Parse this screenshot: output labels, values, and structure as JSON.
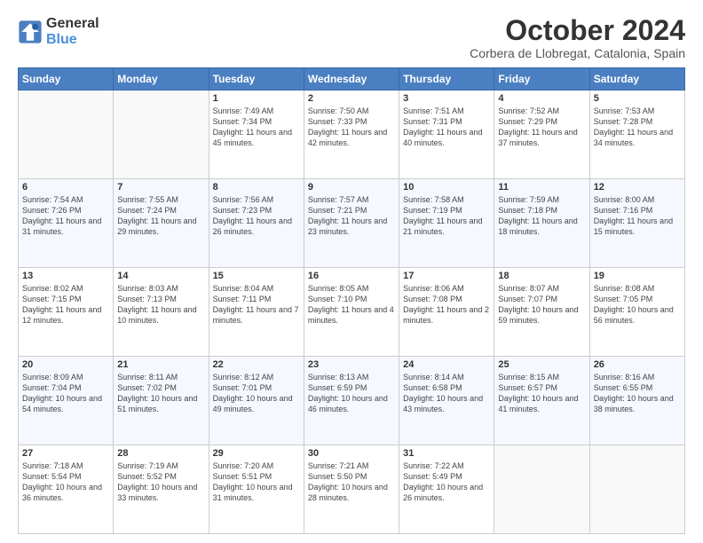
{
  "header": {
    "logo_line1": "General",
    "logo_line2": "Blue",
    "month": "October 2024",
    "location": "Corbera de Llobregat, Catalonia, Spain"
  },
  "weekdays": [
    "Sunday",
    "Monday",
    "Tuesday",
    "Wednesday",
    "Thursday",
    "Friday",
    "Saturday"
  ],
  "weeks": [
    [
      {
        "day": "",
        "info": ""
      },
      {
        "day": "",
        "info": ""
      },
      {
        "day": "1",
        "info": "Sunrise: 7:49 AM\nSunset: 7:34 PM\nDaylight: 11 hours and 45 minutes."
      },
      {
        "day": "2",
        "info": "Sunrise: 7:50 AM\nSunset: 7:33 PM\nDaylight: 11 hours and 42 minutes."
      },
      {
        "day": "3",
        "info": "Sunrise: 7:51 AM\nSunset: 7:31 PM\nDaylight: 11 hours and 40 minutes."
      },
      {
        "day": "4",
        "info": "Sunrise: 7:52 AM\nSunset: 7:29 PM\nDaylight: 11 hours and 37 minutes."
      },
      {
        "day": "5",
        "info": "Sunrise: 7:53 AM\nSunset: 7:28 PM\nDaylight: 11 hours and 34 minutes."
      }
    ],
    [
      {
        "day": "6",
        "info": "Sunrise: 7:54 AM\nSunset: 7:26 PM\nDaylight: 11 hours and 31 minutes."
      },
      {
        "day": "7",
        "info": "Sunrise: 7:55 AM\nSunset: 7:24 PM\nDaylight: 11 hours and 29 minutes."
      },
      {
        "day": "8",
        "info": "Sunrise: 7:56 AM\nSunset: 7:23 PM\nDaylight: 11 hours and 26 minutes."
      },
      {
        "day": "9",
        "info": "Sunrise: 7:57 AM\nSunset: 7:21 PM\nDaylight: 11 hours and 23 minutes."
      },
      {
        "day": "10",
        "info": "Sunrise: 7:58 AM\nSunset: 7:19 PM\nDaylight: 11 hours and 21 minutes."
      },
      {
        "day": "11",
        "info": "Sunrise: 7:59 AM\nSunset: 7:18 PM\nDaylight: 11 hours and 18 minutes."
      },
      {
        "day": "12",
        "info": "Sunrise: 8:00 AM\nSunset: 7:16 PM\nDaylight: 11 hours and 15 minutes."
      }
    ],
    [
      {
        "day": "13",
        "info": "Sunrise: 8:02 AM\nSunset: 7:15 PM\nDaylight: 11 hours and 12 minutes."
      },
      {
        "day": "14",
        "info": "Sunrise: 8:03 AM\nSunset: 7:13 PM\nDaylight: 11 hours and 10 minutes."
      },
      {
        "day": "15",
        "info": "Sunrise: 8:04 AM\nSunset: 7:11 PM\nDaylight: 11 hours and 7 minutes."
      },
      {
        "day": "16",
        "info": "Sunrise: 8:05 AM\nSunset: 7:10 PM\nDaylight: 11 hours and 4 minutes."
      },
      {
        "day": "17",
        "info": "Sunrise: 8:06 AM\nSunset: 7:08 PM\nDaylight: 11 hours and 2 minutes."
      },
      {
        "day": "18",
        "info": "Sunrise: 8:07 AM\nSunset: 7:07 PM\nDaylight: 10 hours and 59 minutes."
      },
      {
        "day": "19",
        "info": "Sunrise: 8:08 AM\nSunset: 7:05 PM\nDaylight: 10 hours and 56 minutes."
      }
    ],
    [
      {
        "day": "20",
        "info": "Sunrise: 8:09 AM\nSunset: 7:04 PM\nDaylight: 10 hours and 54 minutes."
      },
      {
        "day": "21",
        "info": "Sunrise: 8:11 AM\nSunset: 7:02 PM\nDaylight: 10 hours and 51 minutes."
      },
      {
        "day": "22",
        "info": "Sunrise: 8:12 AM\nSunset: 7:01 PM\nDaylight: 10 hours and 49 minutes."
      },
      {
        "day": "23",
        "info": "Sunrise: 8:13 AM\nSunset: 6:59 PM\nDaylight: 10 hours and 46 minutes."
      },
      {
        "day": "24",
        "info": "Sunrise: 8:14 AM\nSunset: 6:58 PM\nDaylight: 10 hours and 43 minutes."
      },
      {
        "day": "25",
        "info": "Sunrise: 8:15 AM\nSunset: 6:57 PM\nDaylight: 10 hours and 41 minutes."
      },
      {
        "day": "26",
        "info": "Sunrise: 8:16 AM\nSunset: 6:55 PM\nDaylight: 10 hours and 38 minutes."
      }
    ],
    [
      {
        "day": "27",
        "info": "Sunrise: 7:18 AM\nSunset: 5:54 PM\nDaylight: 10 hours and 36 minutes."
      },
      {
        "day": "28",
        "info": "Sunrise: 7:19 AM\nSunset: 5:52 PM\nDaylight: 10 hours and 33 minutes."
      },
      {
        "day": "29",
        "info": "Sunrise: 7:20 AM\nSunset: 5:51 PM\nDaylight: 10 hours and 31 minutes."
      },
      {
        "day": "30",
        "info": "Sunrise: 7:21 AM\nSunset: 5:50 PM\nDaylight: 10 hours and 28 minutes."
      },
      {
        "day": "31",
        "info": "Sunrise: 7:22 AM\nSunset: 5:49 PM\nDaylight: 10 hours and 26 minutes."
      },
      {
        "day": "",
        "info": ""
      },
      {
        "day": "",
        "info": ""
      }
    ]
  ]
}
